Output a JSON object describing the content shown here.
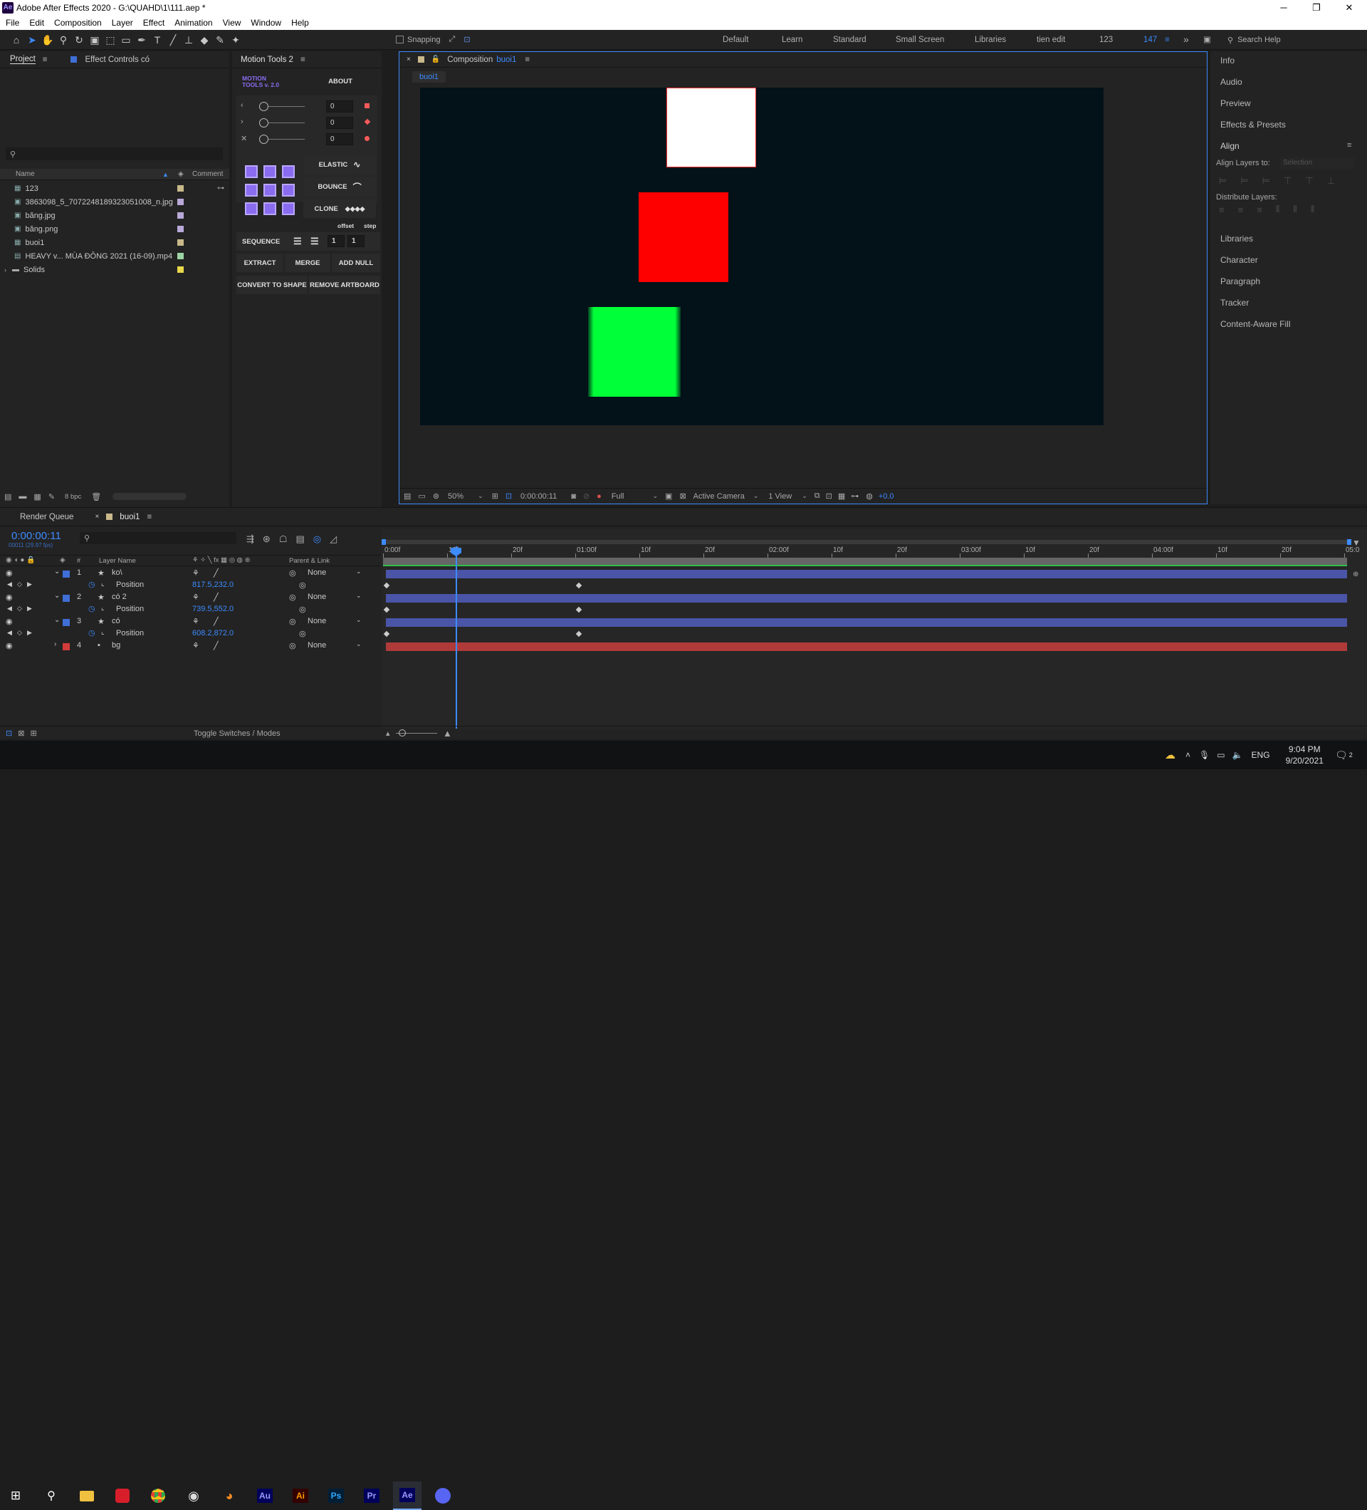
{
  "window": {
    "title": "Adobe After Effects 2020 - G:\\QUAHD\\1\\111.aep *",
    "app_badge": "Ae"
  },
  "menu": [
    "File",
    "Edit",
    "Composition",
    "Layer",
    "Effect",
    "Animation",
    "View",
    "Window",
    "Help"
  ],
  "toolbar": {
    "snapping_label": "Snapping",
    "workspaces": [
      "Default",
      "Learn",
      "Standard",
      "Small Screen",
      "Libraries",
      "tien edit",
      "123"
    ],
    "active_workspace": "147",
    "search_placeholder": "Search Help"
  },
  "project_panel": {
    "tab_project": "Project",
    "tab_effect_controls": "Effect Controls có",
    "columns": {
      "name": "Name",
      "comment": "Comment"
    },
    "items": [
      {
        "name": "123",
        "type": "comp",
        "color": "#c9b98a"
      },
      {
        "name": "3863098_5_7072248189323051008_n.jpg",
        "type": "image",
        "color": "#b8a9d8"
      },
      {
        "name": "băng.jpg",
        "type": "image",
        "color": "#b8a9d8"
      },
      {
        "name": "băng.png",
        "type": "image",
        "color": "#b8a9d8"
      },
      {
        "name": "buoi1",
        "type": "comp",
        "color": "#c9b98a"
      },
      {
        "name": "HEAVY v... MÙA ĐÔNG 2021 (16-09).mp4",
        "type": "video",
        "color": "#9cd4a4"
      },
      {
        "name": "Solids",
        "type": "folder",
        "color": "#e8d84a"
      }
    ],
    "bpc": "8 bpc"
  },
  "motion_tools": {
    "tab": "Motion Tools 2",
    "logo_line1": "MOTION",
    "logo_line2": "TOOLS v. 2.0",
    "about": "ABOUT",
    "sliders": [
      {
        "value": "0",
        "color": "#ff5a5a"
      },
      {
        "value": "0",
        "color": "#ff5a5a"
      },
      {
        "value": "0",
        "color": "#ff5a5a"
      }
    ],
    "elastic": "ELASTIC",
    "bounce": "BOUNCE",
    "clone": "CLONE",
    "offset": "offset",
    "step": "step",
    "sequence": "SEQUENCE",
    "seq_val1": "1",
    "seq_val2": "1",
    "extract": "EXTRACT",
    "merge": "MERGE",
    "add_null": "ADD NULL",
    "convert_to_shape": "CONVERT TO SHAPE",
    "remove_artboard": "REMOVE ARTBOARD",
    "grid_color": "#8a6cf0"
  },
  "composition": {
    "tab": "Composition",
    "comp_name": "buoi1",
    "breadcrumb": "buoi1",
    "footer": {
      "zoom": "50%",
      "timecode": "0:00:00:11",
      "resolution": "Full",
      "camera": "Active Camera",
      "view": "1 View",
      "exposure": "+0.0"
    },
    "bg_color": "#031119",
    "shapes": {
      "white": "#ffffff",
      "red": "#ff0000",
      "green": "#00ff38"
    }
  },
  "right_panel": {
    "items_top": [
      "Info",
      "Audio",
      "Preview",
      "Effects & Presets"
    ],
    "align": {
      "title": "Align",
      "align_layers_to": "Align Layers to:",
      "selection": "Selection",
      "distribute": "Distribute Layers:"
    },
    "items_bottom": [
      "Libraries",
      "Character",
      "Paragraph",
      "Tracker",
      "Content-Aware Fill"
    ]
  },
  "timeline": {
    "tab_render_queue": "Render Queue",
    "tab_comp": "buoi1",
    "timecode": "0:00:00:11",
    "frame_info": "00011 (29.97 fps)",
    "headers": {
      "num": "#",
      "layer_name": "Layer Name",
      "parent": "Parent & Link"
    },
    "ruler": [
      "0:00f",
      "10f",
      "20f",
      "01:00f",
      "10f",
      "20f",
      "02:00f",
      "10f",
      "20f",
      "03:00f",
      "10f",
      "20f",
      "04:00f",
      "10f",
      "20f",
      "05:0"
    ],
    "layers": [
      {
        "num": "1",
        "name": "ko\\",
        "parent": "None",
        "color": "#3f6fd7",
        "prop": "Position",
        "value": "817.5,232.0"
      },
      {
        "num": "2",
        "name": "có 2",
        "parent": "None",
        "color": "#3f6fd7",
        "prop": "Position",
        "value": "739.5,552.0"
      },
      {
        "num": "3",
        "name": "có",
        "parent": "None",
        "color": "#3f6fd7",
        "prop": "Position",
        "value": "608.2,872.0"
      },
      {
        "num": "4",
        "name": "bg",
        "parent": "None",
        "color": "#d23b3b"
      }
    ],
    "toggle_label": "Toggle Switches / Modes",
    "bar_color": "#4a55a8",
    "bg_bar_color": "#b03a3a"
  },
  "taskbar": {
    "apps": [
      "start-icon",
      "search-icon",
      "file-explorer-icon",
      "app-red-icon",
      "chrome-icon",
      "obs-icon",
      "blender-icon",
      "audition-icon",
      "illustrator-icon",
      "photoshop-icon",
      "premiere-icon",
      "after-effects-icon",
      "discord-icon"
    ],
    "lang": "ENG",
    "time": "9:04 PM",
    "date": "9/20/2021",
    "notif_count": "2"
  }
}
